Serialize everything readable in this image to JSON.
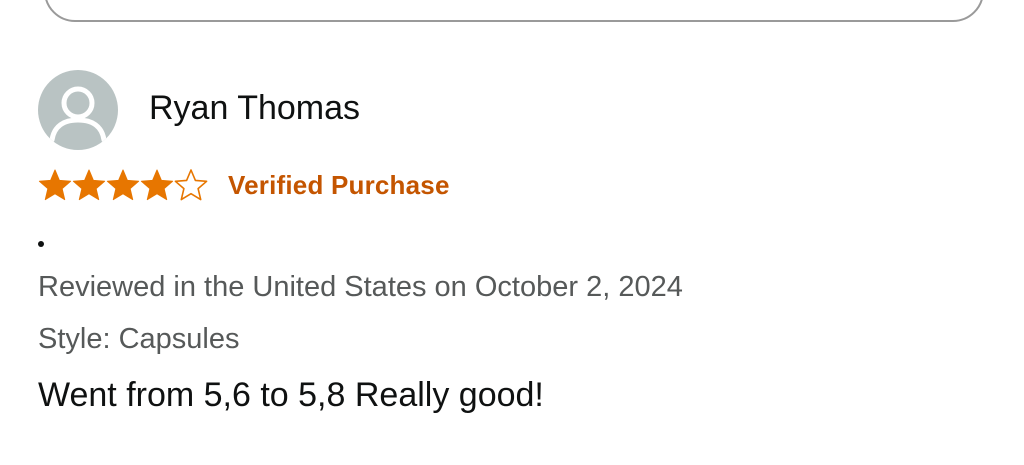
{
  "review": {
    "reviewer_name": "Ryan Thomas",
    "rating": 4,
    "rating_max": 5,
    "verified_label": "Verified Purchase",
    "bullet": "•",
    "date_line": "Reviewed in the United States on October 2, 2024",
    "style_line": "Style: Capsules",
    "body": "Went from 5,6 to 5,8 Really good!"
  },
  "icons": {
    "avatar": "user-avatar-icon",
    "star_filled": "star-filled-icon",
    "star_empty": "star-empty-icon"
  },
  "colors": {
    "star": "#e77600",
    "verified": "#c45500",
    "avatar_bg": "#b9c3c3",
    "secondary_text": "#565959",
    "primary_text": "#0f1111"
  }
}
